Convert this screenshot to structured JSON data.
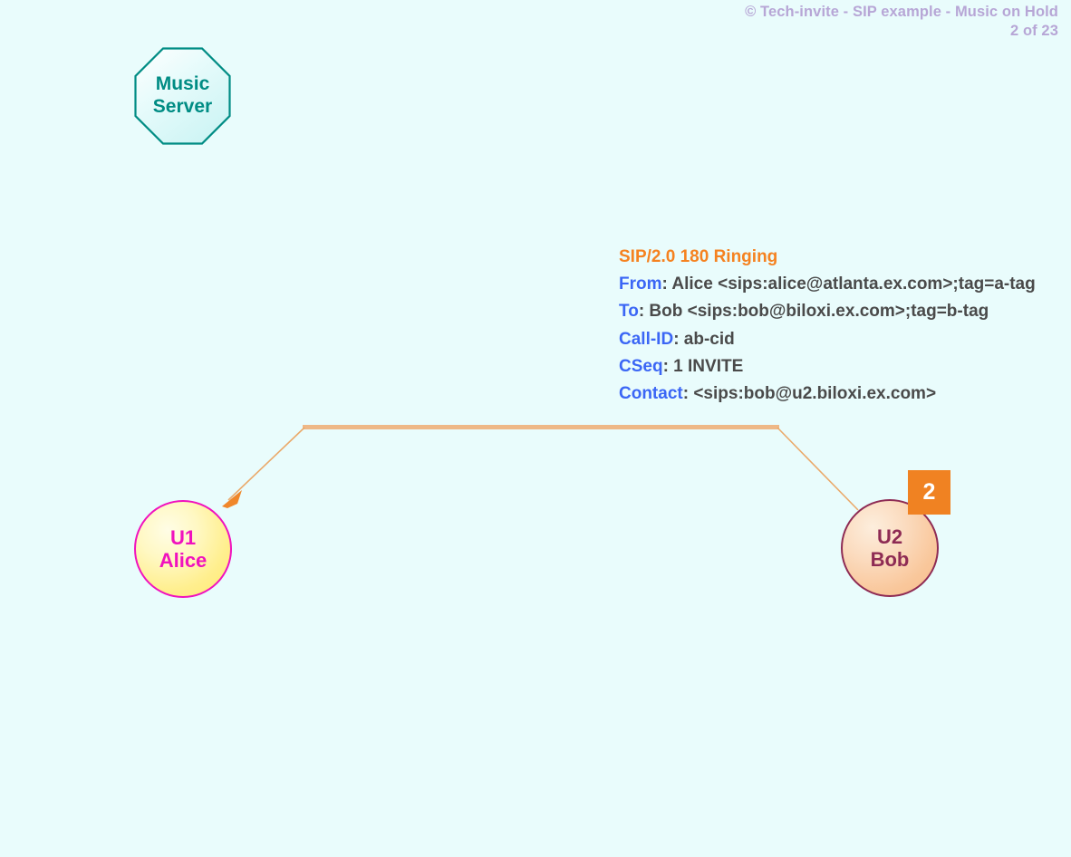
{
  "header": {
    "title": "© Tech-invite - SIP example - Music on Hold",
    "page_indicator": "2 of 23",
    "color": "#b7a6d6"
  },
  "nodes": {
    "music_server": {
      "line1": "Music",
      "line2": "Server",
      "shape": "octagon",
      "border_color": "#008c84",
      "text_color": "#008c84"
    },
    "u1": {
      "line1": "U1",
      "line2": "Alice",
      "shape": "circle",
      "border_color": "#f012be",
      "text_color": "#f012be"
    },
    "u2": {
      "line1": "U2",
      "line2": "Bob",
      "shape": "circle",
      "border_color": "#8e2b54",
      "text_color": "#8e2b54"
    }
  },
  "badge": {
    "step_number": "2",
    "background_color": "#f08222",
    "text_color": "#ffffff"
  },
  "arrow": {
    "direction": "u2-to-u1",
    "color": "#eaa96a",
    "arrowhead_color": "#f08a2a"
  },
  "sip_message": {
    "start_line": "SIP/2.0 180 Ringing",
    "start_line_color": "#f58220",
    "header_name_color": "#3b66f5",
    "header_value_color": "#4a4a4a",
    "headers": [
      {
        "name": "From",
        "value": ": Alice <sips:alice@atlanta.ex.com>;tag=a-tag"
      },
      {
        "name": "To",
        "value": ": Bob <sips:bob@biloxi.ex.com>;tag=b-tag"
      },
      {
        "name": "Call-ID",
        "value": ": ab-cid"
      },
      {
        "name": "CSeq",
        "value": ": 1 INVITE"
      },
      {
        "name": "Contact",
        "value": ": <sips:bob@u2.biloxi.ex.com>"
      }
    ]
  },
  "canvas": {
    "background_color": "#e9fcfc"
  }
}
